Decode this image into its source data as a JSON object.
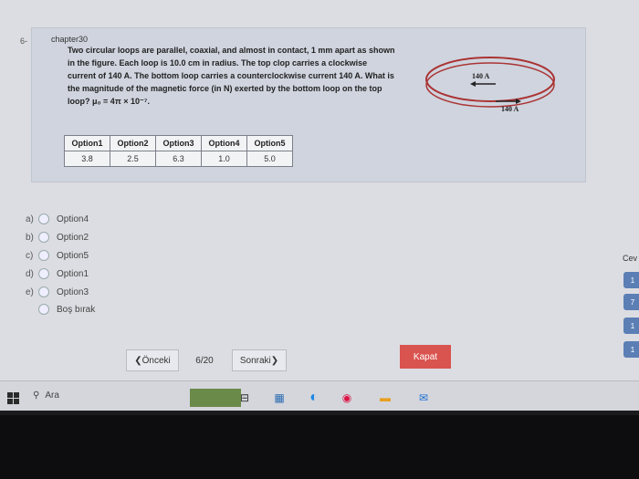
{
  "question": {
    "number": "6-",
    "chapter": "chapter30",
    "text": "Two circular loops are parallel, coaxial, and almost in contact, 1 mm apart as shown in the figure. Each loop is 10.0 cm in radius. The top clop carries a clockwise current of 140 A. The bottom loop carries a counterclockwise current 140 A. What is the magnitude of the magnetic force (in N) exerted by the bottom loop on the top loop? μ₀ = 4π × 10⁻⁷.",
    "figure": {
      "top_label": "140 A",
      "bottom_label": "140 A"
    }
  },
  "table": {
    "headers": [
      "Option1",
      "Option2",
      "Option3",
      "Option4",
      "Option5"
    ],
    "values": [
      "3.8",
      "2.5",
      "6.3",
      "1.0",
      "5.0"
    ]
  },
  "answers": [
    {
      "letter": "a)",
      "label": "Option4"
    },
    {
      "letter": "b)",
      "label": "Option2"
    },
    {
      "letter": "c)",
      "label": "Option5"
    },
    {
      "letter": "d)",
      "label": "Option1"
    },
    {
      "letter": "e)",
      "label": "Option3"
    }
  ],
  "blank_label": "Boş bırak",
  "nav": {
    "prev": "❮Önceki",
    "page": "6/20",
    "next": "Sonraki❯",
    "close": "Kapat"
  },
  "side": {
    "label": "Cev",
    "pills": [
      "1",
      "7",
      "1",
      "1"
    ]
  },
  "taskbar": {
    "search": "Ara"
  }
}
